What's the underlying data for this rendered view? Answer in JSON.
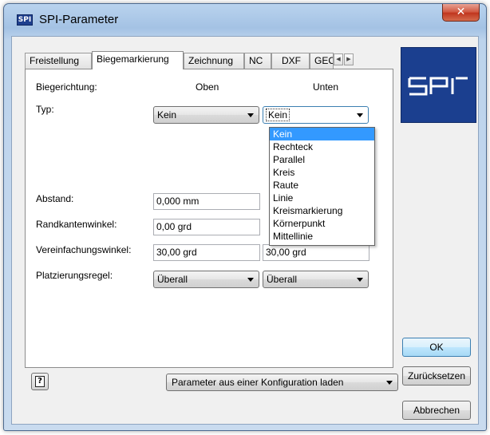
{
  "window": {
    "title": "SPI-Parameter",
    "icon_text": "SPI",
    "close_glyph": "✕"
  },
  "tabs": [
    {
      "label": "Freistellung",
      "active": false
    },
    {
      "label": "Biegemarkierung",
      "active": true
    },
    {
      "label": "Zeichnung",
      "active": false
    },
    {
      "label": "NC",
      "active": false
    },
    {
      "label": "DXF",
      "active": false
    },
    {
      "label": "GEO",
      "active": false
    }
  ],
  "tab_scroll": {
    "left": "◀",
    "right": "▶"
  },
  "form": {
    "direction_label": "Biegerichtung:",
    "col_top": "Oben",
    "col_bottom": "Unten",
    "type_label": "Typ:",
    "type_top_value": "Kein",
    "type_bottom_value": "Kein",
    "distance_label": "Abstand:",
    "distance_top": "0,000 mm",
    "edge_angle_label": "Randkantenwinkel:",
    "edge_angle_top": "0,00 grd",
    "simplify_label": "Vereinfachungswinkel:",
    "simplify_top": "30,00 grd",
    "simplify_bottom": "30,00 grd",
    "placement_label": "Platzierungsregel:",
    "placement_top": "Überall",
    "placement_bottom": "Überall"
  },
  "type_dropdown": {
    "selected": "Kein",
    "options": [
      "Kein",
      "Rechteck",
      "Parallel",
      "Kreis",
      "Raute",
      "Linie",
      "Kreismarkierung",
      "Körnerpunkt",
      "Mittellinie"
    ]
  },
  "logo": {
    "text": "SPI"
  },
  "buttons": {
    "ok": "OK",
    "reset": "Zurücksetzen",
    "cancel": "Abbrechen",
    "load_config": "Parameter aus einer Konfiguration laden",
    "help": "?"
  },
  "colors": {
    "accent": "#3399ff",
    "logo_bg": "#1b3f8f",
    "close_red": "#c0341d"
  }
}
